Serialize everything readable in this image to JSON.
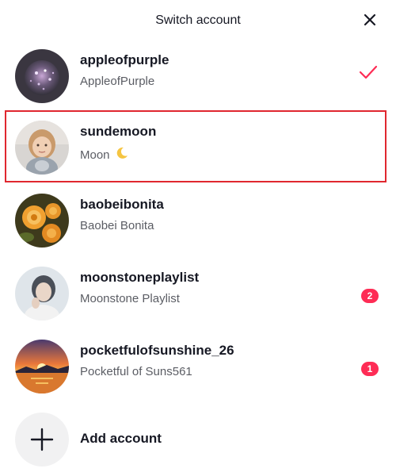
{
  "header": {
    "title": "Switch account"
  },
  "accounts": [
    {
      "username": "appleofpurple",
      "display_name": "AppleofPurple",
      "selected": true,
      "badge": null,
      "avatar_icon": "avatar-disco-ball"
    },
    {
      "username": "sundemoon",
      "display_name": "Moon",
      "display_emoji": "crescent-moon-icon",
      "selected": false,
      "badge": null,
      "avatar_icon": "avatar-child-photo"
    },
    {
      "username": "baobeibonita",
      "display_name": "Baobei Bonita",
      "selected": false,
      "badge": null,
      "avatar_icon": "avatar-orange-flowers"
    },
    {
      "username": "moonstoneplaylist",
      "display_name": "Moonstone Playlist",
      "selected": false,
      "badge": "2",
      "avatar_icon": "avatar-woman-portrait"
    },
    {
      "username": "pocketfulofsunshine_26",
      "display_name": "Pocketful of Suns561",
      "selected": false,
      "badge": "1",
      "avatar_icon": "avatar-sunset"
    }
  ],
  "add_account": {
    "label": "Add account"
  },
  "colors": {
    "accent": "#fe2c55",
    "highlight_border": "#e0272f",
    "primary_text": "#161823",
    "secondary_text": "#5b5d64"
  }
}
